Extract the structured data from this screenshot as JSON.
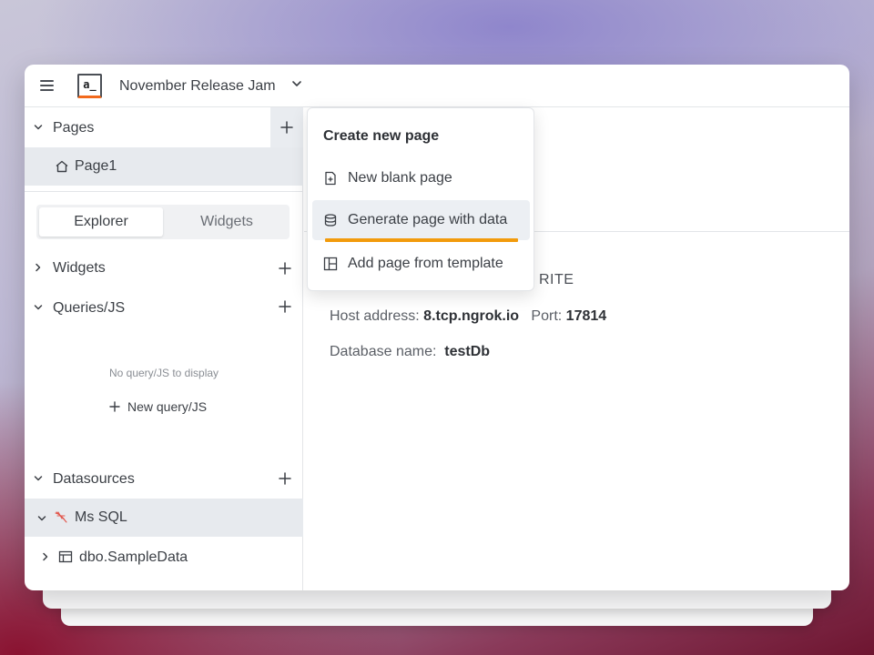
{
  "app": {
    "name": "November Release Jam",
    "logo_text": "a_"
  },
  "sidebar": {
    "pages_label": "Pages",
    "page_item": "Page1",
    "tabs": [
      {
        "label": "Explorer",
        "active": true
      },
      {
        "label": "Widgets",
        "active": false
      }
    ],
    "widgets_label": "Widgets",
    "queries_label": "Queries/JS",
    "empty_queries": "No query/JS to display",
    "new_query": "New query/JS",
    "datasources_label": "Datasources",
    "datasource": "Ms SQL",
    "table": "dbo.SampleData"
  },
  "menu": {
    "title": "Create new page",
    "items": [
      {
        "label": "New blank page",
        "icon": "file-add-icon"
      },
      {
        "label": "Generate page with data",
        "icon": "database-icon",
        "highlighted": true
      },
      {
        "label": "Add page from template",
        "icon": "layout-icon"
      }
    ]
  },
  "main": {
    "datasource_title_partial": "RITE",
    "host_label": "Host address:",
    "host_value": "8.tcp.ngrok.io",
    "port_label": "Port:",
    "port_value": "17814",
    "db_label": "Database name:",
    "db_value": "testDb"
  },
  "colors": {
    "accent": "#f29b0c",
    "logo_accent": "#f2691c",
    "selection": "#e7eaee"
  }
}
